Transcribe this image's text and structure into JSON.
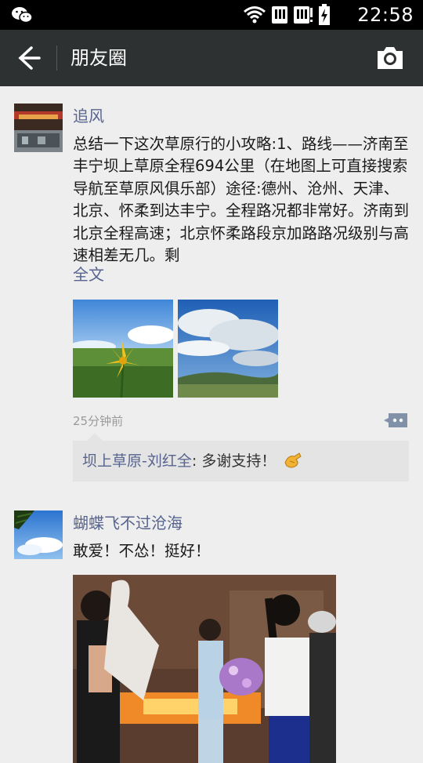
{
  "status_bar": {
    "time": "22:58",
    "icons": [
      "wechat-icon",
      "wifi-icon",
      "sim1-signal-icon",
      "sim2-signal-icon",
      "battery-charging-icon"
    ]
  },
  "header": {
    "title": "朋友圈",
    "back_icon": "back-arrow-icon",
    "camera_icon": "camera-icon"
  },
  "posts": [
    {
      "author": "追风",
      "text": "总结一下这次草原行的小攻略:1、路线——济南至丰宁坝上草原全程694公里（在地图上可直接搜索导航至草原风俱乐部）途径:德州、沧州、天津、北京、怀柔到达丰宁。全程路况都非常好。济南到北京全程高速；北京怀柔路段京加路路况级别与高速相差无几。剩",
      "more_label": "全文",
      "photos": [
        "yellow-lily-flower-photo",
        "sky-clouds-grassland-photo"
      ],
      "time_ago": "25分钟前",
      "comment": {
        "author": "坝上草原-刘红全",
        "separator": ": ",
        "text": "多谢支持！",
        "emoji": "fist-bump-emoji"
      }
    },
    {
      "author": "蝴蝶飞不过沧海",
      "text": "敢爱！不怂！挺好！",
      "video": "people-at-party-video-thumbnail"
    }
  ],
  "colors": {
    "status_bar": "#000000",
    "title_bar": "#2e3132",
    "background": "#eeeeee",
    "link_name": "#56648f",
    "comment_bg": "#e4e4e4"
  }
}
